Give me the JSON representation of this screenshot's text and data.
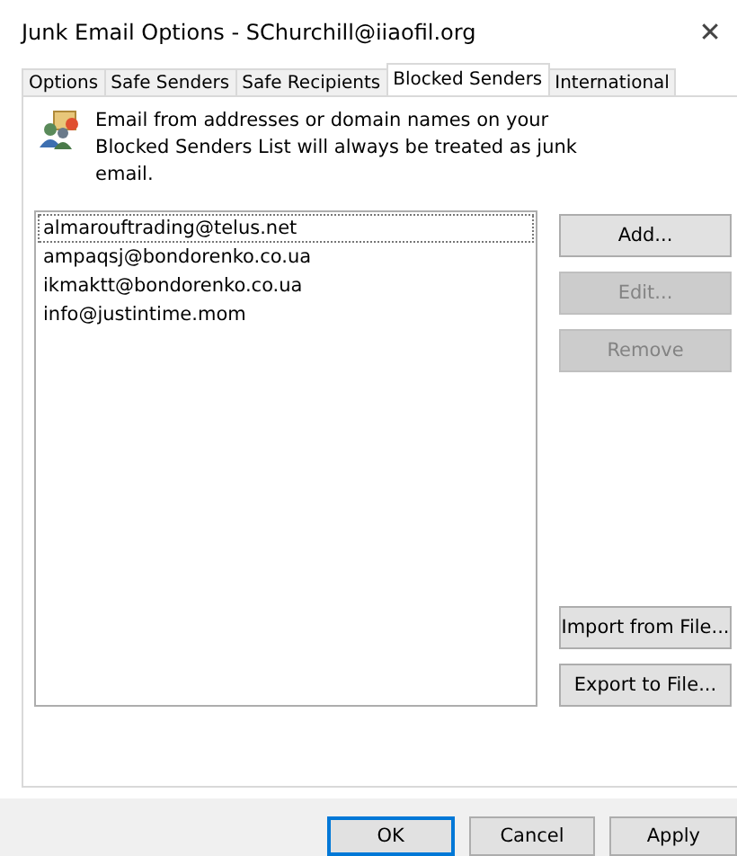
{
  "window": {
    "title": "Junk Email Options - SChurchill@iiaofil.org",
    "close": "✕"
  },
  "tabs": [
    {
      "label": "Options",
      "selected": false
    },
    {
      "label": "Safe Senders",
      "selected": false
    },
    {
      "label": "Safe Recipients",
      "selected": false
    },
    {
      "label": "Blocked Senders",
      "selected": true
    },
    {
      "label": "International",
      "selected": false
    }
  ],
  "description": "Email from addresses or domain names on your Blocked Senders List will always be treated as junk email.",
  "senders": [
    {
      "address": "almarouftrading@telus.net",
      "focused": true
    },
    {
      "address": "ampaqsj@bondorenko.co.ua",
      "focused": false
    },
    {
      "address": "ikmaktt@bondorenko.co.ua",
      "focused": false
    },
    {
      "address": "info@justintime.mom",
      "focused": false
    }
  ],
  "side_buttons": [
    {
      "label": "Add...",
      "disabled": false
    },
    {
      "label": "Edit...",
      "disabled": true
    },
    {
      "label": "Remove",
      "disabled": true
    }
  ],
  "file_buttons": [
    {
      "label": "Import from File...",
      "disabled": false
    },
    {
      "label": "Export to File...",
      "disabled": false
    }
  ],
  "footer_buttons": [
    {
      "label": "OK",
      "default": true
    },
    {
      "label": "Cancel",
      "default": false
    },
    {
      "label": "Apply",
      "default": false
    }
  ]
}
